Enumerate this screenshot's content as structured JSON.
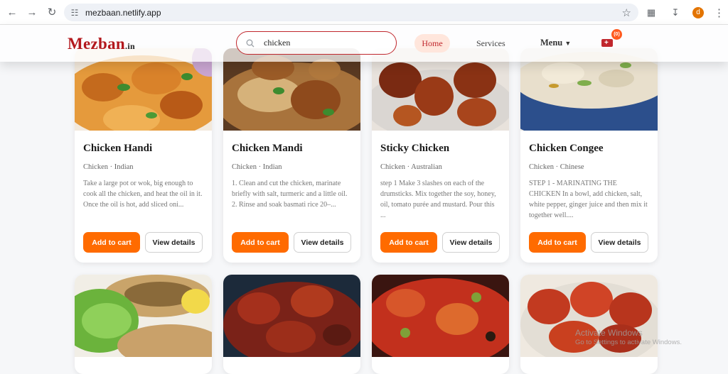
{
  "browser": {
    "url": "mezbaan.netlify.app",
    "profile_initial": "d"
  },
  "header": {
    "logo_main": "Mezban",
    "logo_sub": ".in",
    "search_value": "chicken",
    "nav_home": "Home",
    "nav_services": "Services",
    "nav_menu": "Menu",
    "cart_count": "0"
  },
  "cards": [
    {
      "title": "Chicken Handi",
      "category": "Chicken",
      "area": "Indian",
      "meta": "Chicken · Indian",
      "desc": "Take a large pot or wok, big enough to cook all the chicken, and heat the oil in it. Once the oil is hot, add sliced oni...",
      "add_label": "Add to cart",
      "view_label": "View details"
    },
    {
      "title": "Chicken Mandi",
      "category": "Chicken",
      "area": "Indian",
      "meta": "Chicken · Indian",
      "desc": "1. Clean and cut the chicken, marinate briefly with salt, turmeric and a little oil. 2. Rinse and soak basmati rice 20–...",
      "add_label": "Add to cart",
      "view_label": "View details"
    },
    {
      "title": "Sticky Chicken",
      "category": "Chicken",
      "area": "Australian",
      "meta": "Chicken · Australian",
      "desc": "step 1 Make 3 slashes on each of the drumsticks. Mix together the soy, honey, oil, tomato purée and mustard. Pour this ...",
      "add_label": "Add to cart",
      "view_label": "View details"
    },
    {
      "title": "Chicken Congee",
      "category": "Chicken",
      "area": "Chinese",
      "meta": "Chicken · Chinese",
      "desc": "STEP 1 - MARINATING THE CHICKEN In a bowl, add chicken, salt, white pepper, ginger juice and then mix it together well....",
      "add_label": "Add to cart",
      "view_label": "View details"
    }
  ],
  "watermark": {
    "line1": "Activate Windows",
    "line2": "Go to Settings to activate Windows."
  }
}
